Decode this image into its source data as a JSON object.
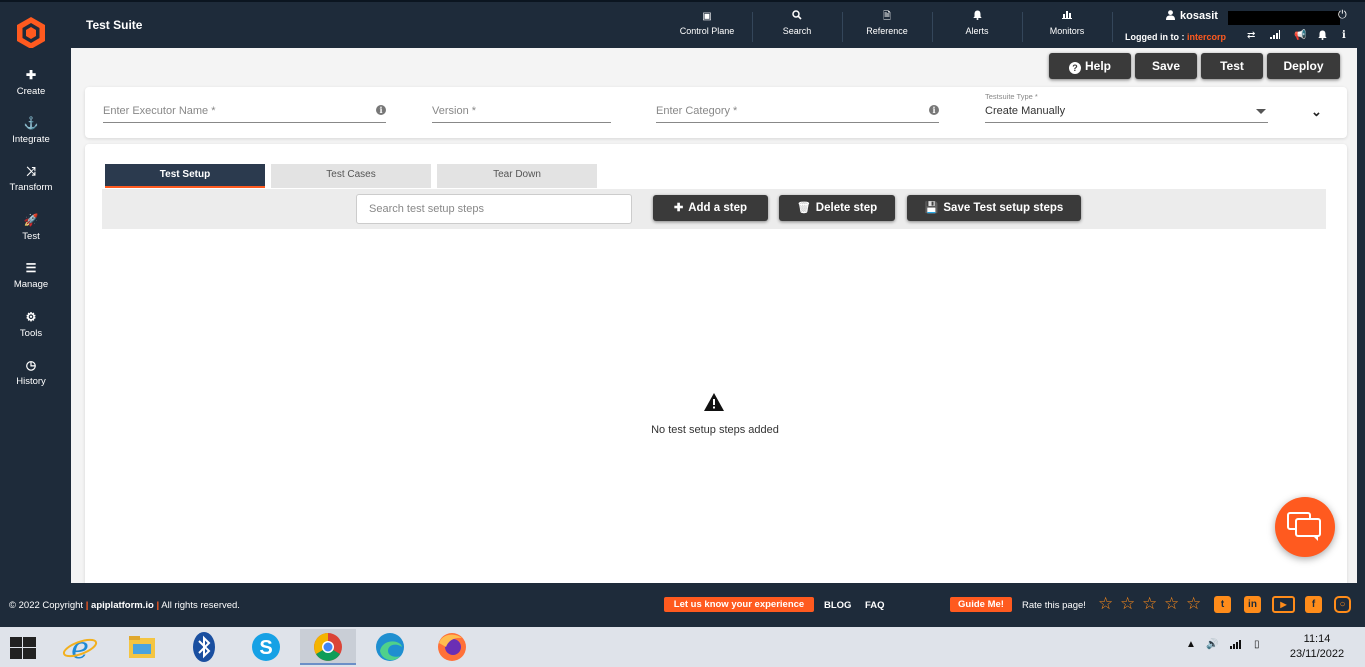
{
  "header": {
    "title": "Test Suite",
    "nav": [
      {
        "label": "Control Plane",
        "icon": "image-icon"
      },
      {
        "label": "Search",
        "icon": "search-icon"
      },
      {
        "label": "Reference",
        "icon": "document-icon"
      },
      {
        "label": "Alerts",
        "icon": "bell-icon"
      },
      {
        "label": "Monitors",
        "icon": "bar-chart-icon"
      }
    ],
    "user": {
      "name": "kosasit",
      "logged_in_prefix": "Logged in to :",
      "org": "intercorp"
    }
  },
  "sidebar": {
    "items": [
      {
        "label": "Create",
        "icon": "plus-icon"
      },
      {
        "label": "Integrate",
        "icon": "anchor-icon"
      },
      {
        "label": "Transform",
        "icon": "shuffle-icon"
      },
      {
        "label": "Test",
        "icon": "rocket-icon"
      },
      {
        "label": "Manage",
        "icon": "server-icon"
      },
      {
        "label": "Tools",
        "icon": "tools-icon"
      },
      {
        "label": "History",
        "icon": "clock-icon"
      }
    ]
  },
  "actions": {
    "help": "Help",
    "save": "Save",
    "test": "Test",
    "deploy": "Deploy"
  },
  "form": {
    "executor_placeholder": "Enter Executor Name *",
    "version_placeholder": "Version *",
    "category_placeholder": "Enter Category *",
    "type_label": "Testsuite Type *",
    "type_value": "Create Manually"
  },
  "tabs": [
    {
      "label": "Test Setup",
      "active": true
    },
    {
      "label": "Test Cases",
      "active": false
    },
    {
      "label": "Tear Down",
      "active": false
    }
  ],
  "toolbar": {
    "search_placeholder": "Search test setup steps",
    "add_label": "Add a step",
    "delete_label": "Delete step",
    "save_label": "Save Test setup steps"
  },
  "empty_state": {
    "text": "No test setup steps added"
  },
  "footer": {
    "copyright_prefix": "© 2022 Copyright",
    "brand": "apiplatform.io",
    "rights": "All rights reserved.",
    "feedback": "Let us know your experience",
    "blog": "BLOG",
    "faq": "FAQ",
    "guide": "Guide Me!",
    "rate": "Rate this page!"
  },
  "taskbar": {
    "time": "11:14",
    "date": "23/11/2022"
  },
  "colors": {
    "dark": "#1e2b3a",
    "accent": "#ff5a1f",
    "button": "#3a3a3a",
    "star": "#ff8c1a"
  }
}
